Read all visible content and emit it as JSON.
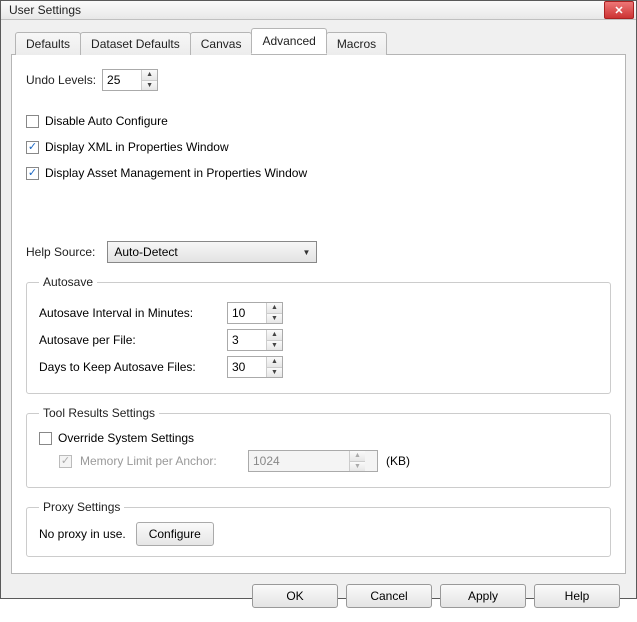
{
  "window": {
    "title": "User Settings"
  },
  "tabs": [
    {
      "label": "Defaults"
    },
    {
      "label": "Dataset Defaults"
    },
    {
      "label": "Canvas"
    },
    {
      "label": "Advanced"
    },
    {
      "label": "Macros"
    }
  ],
  "undo": {
    "label": "Undo Levels:",
    "value": "25"
  },
  "checks": {
    "disable_auto_configure": {
      "label": "Disable Auto Configure",
      "checked": false
    },
    "display_xml": {
      "label": "Display XML in Properties Window",
      "checked": true
    },
    "display_asset_mgmt": {
      "label": "Display Asset Management in Properties Window",
      "checked": true
    }
  },
  "help_source": {
    "label": "Help Source:",
    "value": "Auto-Detect"
  },
  "autosave": {
    "legend": "Autosave",
    "interval": {
      "label": "Autosave Interval in Minutes:",
      "value": "10"
    },
    "per_file": {
      "label": "Autosave per File:",
      "value": "3"
    },
    "days_keep": {
      "label": "Days to Keep Autosave Files:",
      "value": "30"
    }
  },
  "tool_results": {
    "legend": "Tool Results Settings",
    "override": {
      "label": "Override System Settings",
      "checked": false
    },
    "memory_limit": {
      "label": "Memory Limit per Anchor:",
      "value": "1024",
      "unit": "(KB)",
      "checked": true
    }
  },
  "proxy": {
    "legend": "Proxy Settings",
    "status": "No proxy in use.",
    "configure": "Configure"
  },
  "buttons": {
    "ok": "OK",
    "cancel": "Cancel",
    "apply": "Apply",
    "help": "Help"
  }
}
